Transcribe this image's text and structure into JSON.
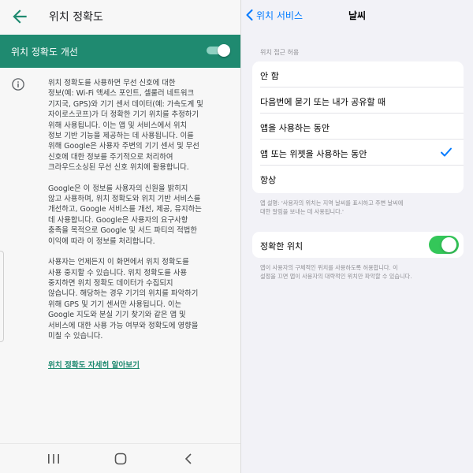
{
  "left": {
    "title": "위치 정확도",
    "toggle_label": "위치 정확도 개선",
    "toggle_on": true,
    "accent_color": "#1f8a70",
    "paragraphs": [
      [
        "위치 정확도를 사용하면 무선 신호에 대한",
        "정보(예: Wi-Fi 액세스 포인트, 셀룰러 네트워크",
        "기지국, GPS)와 기기 센서 데이터(예: 가속도계 및",
        "자이로스코프)가 더 정확한 기기 위치를 추정하기",
        "위해 사용됩니다. 이는 앱 및 서비스에서 위치",
        "정보 기반 기능을 제공하는 데 사용됩니다. 이를",
        "위해 Google은 사용자 주변의 기기 센서 및 무선",
        "신호에 대한 정보를 주기적으로 처리하여",
        "크라우드소싱된 무선 신호 위치에 활용합니다."
      ],
      [
        "Google은 이 정보를 사용자의 신원을 밝히지",
        "않고 사용하며, 위치 정확도와 위치 기반 서비스를",
        "개선하고, Google 서비스를 개선, 제공, 유지하는",
        "데 사용합니다. Google은 사용자의 요구사항",
        "충족을 목적으로 Google 및 서드 파티의 적법한",
        "이익에 따라 이 정보를 처리합니다."
      ],
      [
        "사용자는 언제든지 이 화면에서 위치 정확도를",
        "사용 중지할 수 있습니다. 위치 정확도를 사용",
        "중지하면 위치 정확도 데이터가 수집되지",
        "않습니다. 해당하는 경우 기기의 위치를 파악하기",
        "위해 GPS 및 기기 센서만 사용됩니다. 이는",
        "Google 지도와 분실 기기 찾기와 같은 앱 및",
        "서비스에 대한 사용 가능 여부와 정확도에 영향을",
        "미칠 수 있습니다."
      ]
    ],
    "link_text": "위치 정확도 자세히 알아보기",
    "icons": {
      "back": "arrow-left-icon",
      "info": "info-icon",
      "nav_recents": "recents-icon",
      "nav_home": "home-icon",
      "nav_back": "back-icon"
    }
  },
  "right": {
    "back_label": "위치 서비스",
    "title": "날씨",
    "section_label": "위치 접근 허용",
    "options": [
      {
        "label": "안 함",
        "selected": false
      },
      {
        "label": "다음번에 묻기 또는 내가 공유할 때",
        "selected": false
      },
      {
        "label": "앱을 사용하는 동안",
        "selected": false
      },
      {
        "label": "앱 또는 위젯을 사용하는 동안",
        "selected": true
      },
      {
        "label": "항상",
        "selected": false
      }
    ],
    "app_description": [
      "앱 설명: '사용자의 위치는 지역 날씨를 표시하고 주변 날씨에",
      "대한 알림을 보내는 데 사용됩니다.'"
    ],
    "precise_label": "정확한 위치",
    "precise_on": true,
    "precise_note": [
      "앱이 사용자의 구체적인 위치를 사용하도록 허용합니다. 이",
      "설정을 끄면 앱이 사용자의 대략적인 위치만 파악할 수 있습니다."
    ],
    "accent_color": "#007aff",
    "toggle_color": "#34c759"
  }
}
